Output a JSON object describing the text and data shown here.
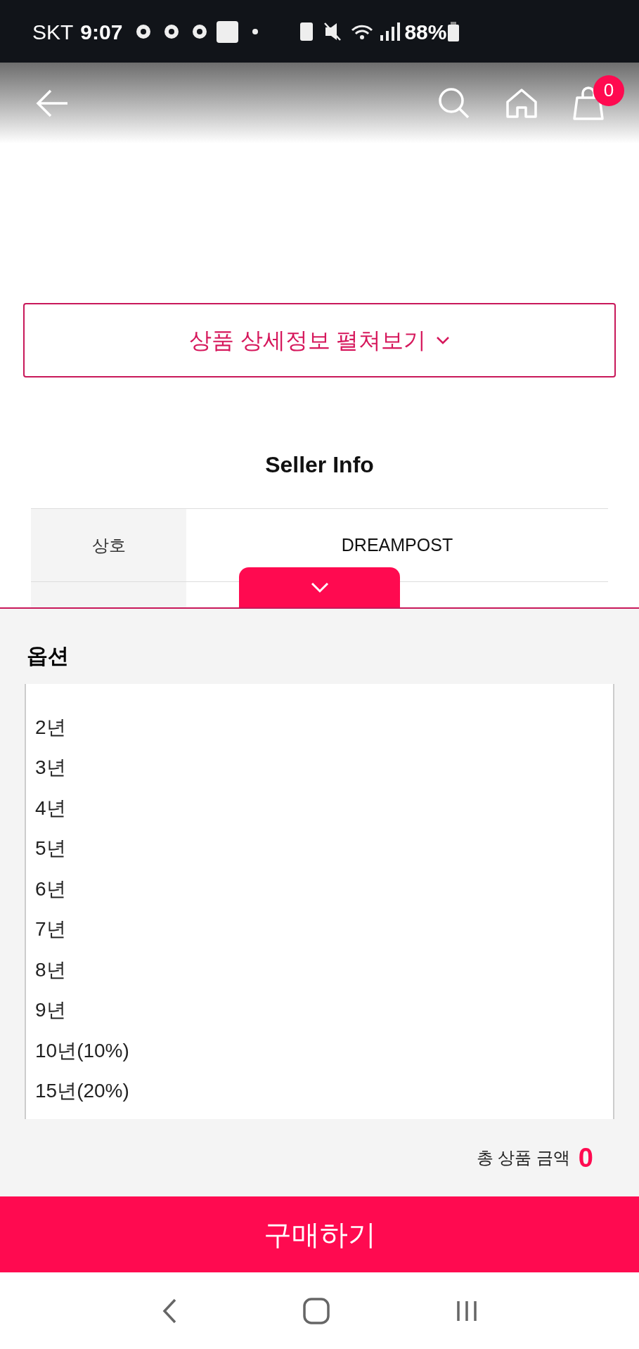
{
  "status_bar": {
    "carrier": "SKT",
    "time": "9:07",
    "battery": "88%"
  },
  "header": {
    "cart_count": "0"
  },
  "detail_button": {
    "label": "상품 상세정보 펼쳐보기"
  },
  "seller_info": {
    "title": "Seller Info",
    "rows": [
      {
        "label": "상호",
        "value": "DREAMPOST"
      }
    ]
  },
  "option_panel": {
    "title": "옵션",
    "options": [
      "2년",
      "3년",
      "4년",
      "5년",
      "6년",
      "7년",
      "8년",
      "9년",
      "10년(10%)",
      "15년(20%)"
    ]
  },
  "total": {
    "label": "총 상품 금액",
    "amount": "0"
  },
  "buy_button": {
    "label": "구매하기"
  }
}
